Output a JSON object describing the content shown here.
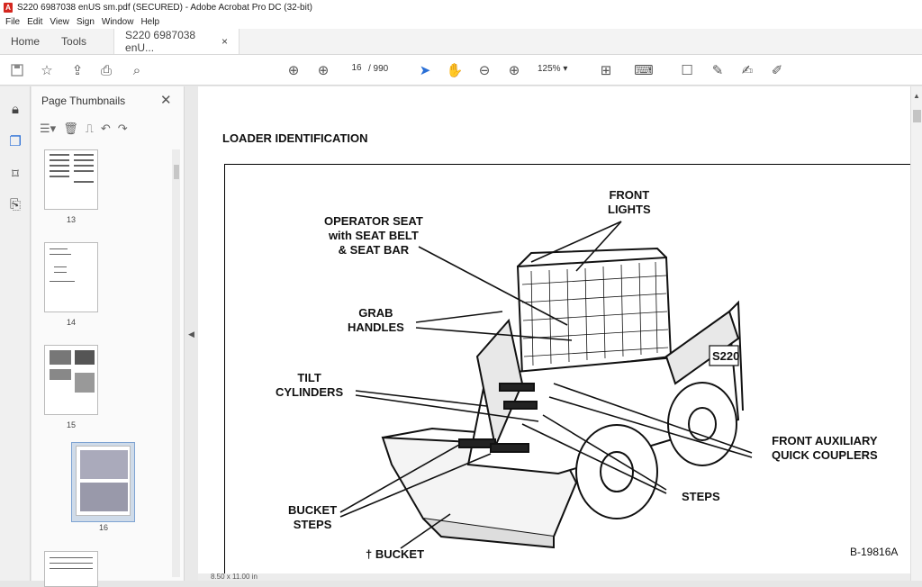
{
  "window": {
    "title": "S220 6987038 enUS sm.pdf (SECURED) - Adobe Acrobat Pro DC (32-bit)"
  },
  "menu": [
    "File",
    "Edit",
    "View",
    "Sign",
    "Window",
    "Help"
  ],
  "tabs": {
    "home": "Home",
    "tools": "Tools",
    "doc": "S220 6987038 enU...",
    "close": "×"
  },
  "toolbar": {
    "page_current": "16",
    "page_total": "/ 990",
    "zoom": "125%  ▾"
  },
  "thumbnails": {
    "title": "Page Thumbnails",
    "close": "✕",
    "pages": [
      "13",
      "14",
      "15",
      "16"
    ]
  },
  "document": {
    "heading": "LOADER IDENTIFICATION",
    "labels": {
      "front_lights": "FRONT\nLIGHTS",
      "operator_seat": "OPERATOR SEAT\nwith SEAT BELT\n& SEAT BAR",
      "grab_handles": "GRAB\nHANDLES",
      "tilt_cylinders": "TILT\nCYLINDERS",
      "front_aux": "FRONT AUXILIARY\nQUICK COUPLERS",
      "steps": "STEPS",
      "bucket_steps": "BUCKET\nSTEPS",
      "bucket": "† BUCKET",
      "figure_code": "B-19816A",
      "model_badge": "S220"
    }
  },
  "statusbar": {
    "size": "8.50 x 11.00 in"
  }
}
